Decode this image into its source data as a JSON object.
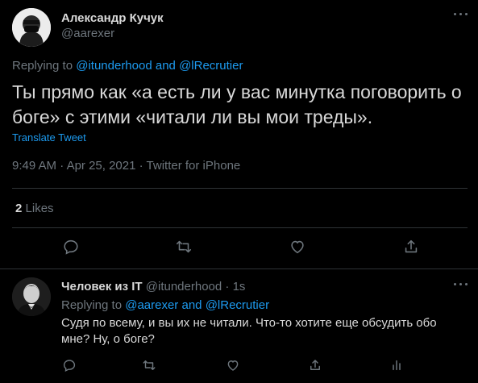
{
  "main_tweet": {
    "author_name": "Александр Кучук",
    "author_handle": "@aarexer",
    "replying_prefix": "Replying to",
    "replying_user1": "@itunderhood",
    "replying_and": "and",
    "replying_user2": "@lRecrutier",
    "text": "Ты прямо как «а есть ли у вас минутка поговорить о боге» с этими «читали ли вы мои треды».",
    "translate_label": "Translate Tweet",
    "time": "9:49 AM",
    "date": "Apr 25, 2021",
    "source": "Twitter for iPhone",
    "separator": "·",
    "likes_count": "2",
    "likes_label": "Likes"
  },
  "reply_tweet": {
    "author_name": "Человек из IT",
    "author_handle": "@itunderhood",
    "time_ago": "1s",
    "separator": "·",
    "replying_prefix": "Replying to",
    "replying_user1": "@aarexer",
    "replying_and": "and",
    "replying_user2": "@lRecrutier",
    "text": "Судя по всему, и вы их не читали. Что-то хотите еще обсудить обо мне? Ну, о боге?"
  },
  "colors": {
    "background": "#000000",
    "text": "#d9d9d9",
    "muted": "#6e767d",
    "accent": "#1d9bf0",
    "divider": "#2f3336"
  },
  "icons": {
    "reply": "reply-icon",
    "retweet": "retweet-icon",
    "like": "heart-icon",
    "share": "share-icon",
    "analytics": "analytics-icon",
    "more": "more-icon"
  }
}
